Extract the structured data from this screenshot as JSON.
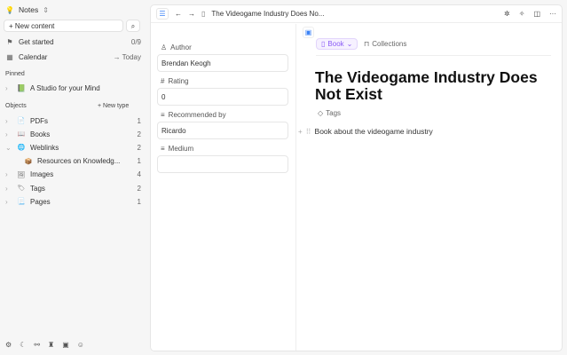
{
  "sidebar": {
    "space": "Notes",
    "new_content": "+ New content",
    "get_started": "Get started",
    "get_started_count": "0/9",
    "calendar": "Calendar",
    "today": "Today",
    "pinned_label": "Pinned",
    "pinned": [
      {
        "label": "A Studio for your Mind"
      }
    ],
    "objects_label": "Objects",
    "new_type": "+ New type",
    "objects": [
      {
        "label": "PDFs",
        "count": "1",
        "icon": "📄"
      },
      {
        "label": "Books",
        "count": "2",
        "icon": "📖"
      },
      {
        "label": "Weblinks",
        "count": "2",
        "icon": "🌐"
      },
      {
        "label": "Resources on Knowledg...",
        "count": "1",
        "icon": "📦"
      },
      {
        "label": "Images",
        "count": "4",
        "icon": "🖼"
      },
      {
        "label": "Tags",
        "count": "2",
        "icon": "🏷"
      },
      {
        "label": "Pages",
        "count": "1",
        "icon": "📃"
      }
    ]
  },
  "topbar": {
    "breadcrumb": "The Videogame Industry Does No..."
  },
  "props": [
    {
      "label": "Author",
      "value": "Brendan Keogh",
      "icon": "person"
    },
    {
      "label": "Rating",
      "value": "0",
      "icon": "hash"
    },
    {
      "label": "Recommended by",
      "value": "Ricardo",
      "icon": "list"
    },
    {
      "label": "Medium",
      "value": "",
      "icon": "menu"
    }
  ],
  "doc": {
    "type": "Book",
    "collections": "Collections",
    "title": "The Videogame Industry Does Not Exist",
    "tags": "Tags",
    "body": "Book about the videogame industry"
  },
  "colors": {
    "accent": "#8b5cf6",
    "blue": "#3b82f6"
  }
}
